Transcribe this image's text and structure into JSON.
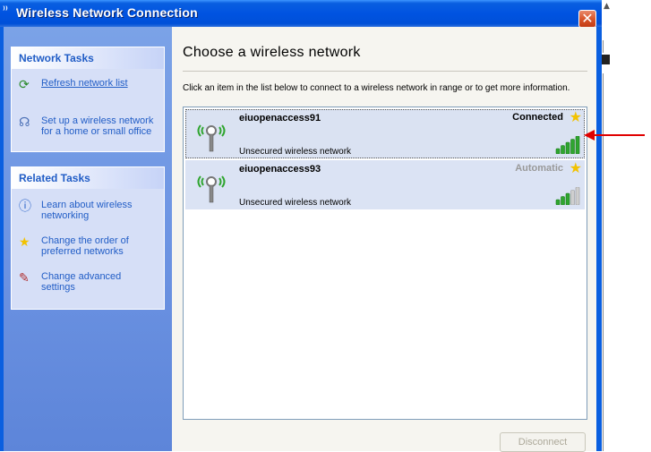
{
  "window": {
    "title": "Wireless Network Connection",
    "title_icon": "wireless-icon",
    "close_label": "✕"
  },
  "network_tasks": {
    "header": "Network Tasks",
    "items": [
      {
        "label": "Refresh network list",
        "icon": "refresh-icon"
      },
      {
        "label": "Set up a wireless network for a home or small office",
        "icon": "setup-wireless-icon"
      }
    ]
  },
  "related_tasks": {
    "header": "Related Tasks",
    "items": [
      {
        "label": "Learn about wireless networking",
        "icon": "info-icon"
      },
      {
        "label": "Change the order of preferred networks",
        "icon": "star-icon"
      },
      {
        "label": "Change advanced settings",
        "icon": "settings-icon"
      }
    ]
  },
  "main": {
    "title": "Choose a wireless network",
    "instructions": "Click an item in the list below to connect to a wireless network in range or to get more information.",
    "networks": [
      {
        "name": "eiuopenaccess91",
        "security": "Unsecured wireless network",
        "status": "Connected",
        "signal_bars": 5,
        "selected": true
      },
      {
        "name": "eiuopenaccess93",
        "security": "Unsecured wireless network",
        "status": "Automatic",
        "signal_bars": 3,
        "selected": false
      }
    ],
    "disconnect_label": "Disconnect"
  },
  "colors": {
    "title_bar": "#0053e1",
    "task_pane": "#6d94e3",
    "task_link": "#215dc6",
    "signal_on": "#2fa52f",
    "signal_off": "#cfcfcf",
    "arrow": "#e00000"
  }
}
